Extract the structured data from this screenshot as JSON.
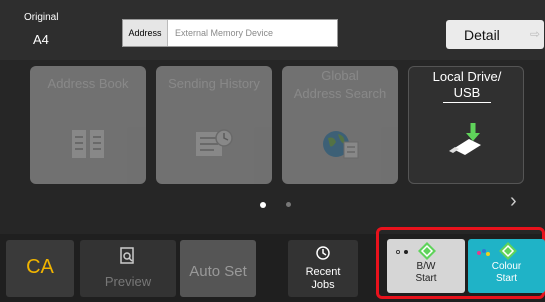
{
  "header": {
    "original_label": "Original",
    "original_value": "A4",
    "address_label": "Address",
    "address_value": "External Memory Device",
    "detail_button": "Detail"
  },
  "tiles": [
    {
      "label_1": "Address Book",
      "label_2": "",
      "state": "disabled",
      "icon": "address-book-icon"
    },
    {
      "label_1": "Sending History",
      "label_2": "",
      "state": "disabled",
      "icon": "sending-history-icon"
    },
    {
      "label_1": "Global",
      "label_2": "Address Search",
      "state": "disabled",
      "icon": "global-address-search-icon"
    },
    {
      "label_1": "Local Drive/",
      "label_2": "USB",
      "state": "active",
      "icon": "usb-drive-icon"
    }
  ],
  "pager": {
    "pages": 2,
    "current": 1
  },
  "bottom": {
    "ca": "CA",
    "preview": "Preview",
    "auto_set": "Auto Set",
    "recent_1": "Recent",
    "recent_2": "Jobs",
    "bw_1": "B/W",
    "bw_2": "Start",
    "colour_1": "Colour",
    "colour_2": "Start"
  },
  "colors": {
    "accent_start_colour": "#1fb3c7",
    "highlight_frame": "#e8121c",
    "ca_text": "#f0b400",
    "diamond_green": "#5fd35a"
  }
}
